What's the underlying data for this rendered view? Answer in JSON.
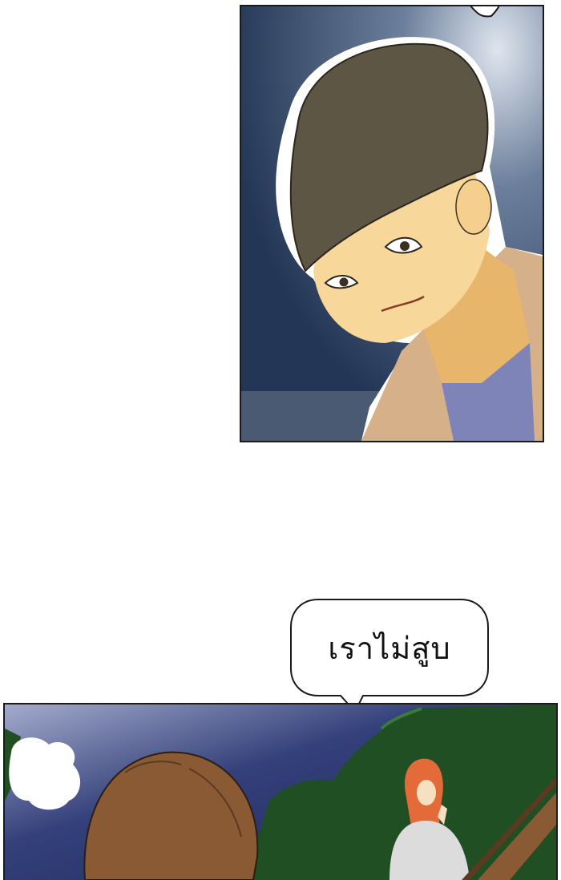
{
  "speech_bubble": {
    "text": "เราไม่สูบ"
  },
  "colors": {
    "night_sky": "#2d4160",
    "hair": "#5e5645",
    "skin": "#f7d79a",
    "jacket": "#d6b088",
    "shirt": "#7f84b8",
    "foliage": "#1f4f22",
    "red_hair": "#e56a3a"
  }
}
